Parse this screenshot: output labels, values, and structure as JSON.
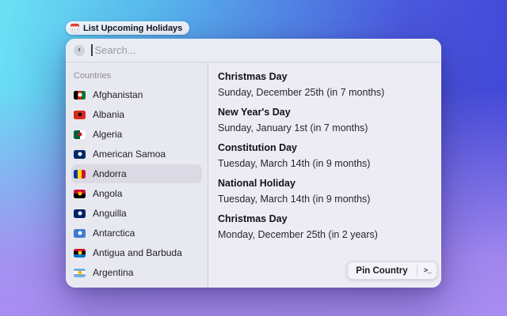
{
  "colors": {
    "bg_gradient_top_left": "#6be1f5",
    "bg_gradient_top_right": "#3f42d5",
    "bg_gradient_bottom": "#a88df0",
    "window_bg": "#eceaf4",
    "selected_row_bg": "#dbd9e3"
  },
  "launcher_pill": {
    "label": "List Upcoming Holidays",
    "icon": "calendar-icon"
  },
  "search": {
    "placeholder": "Search...",
    "value": "",
    "back_icon": "chevron-left-icon"
  },
  "sidebar": {
    "section_label": "Countries",
    "items": [
      {
        "name": "Afghanistan",
        "selected": false,
        "flag": {
          "dir": "v",
          "colors": [
            "#000000",
            "#d32011",
            "#007a36"
          ],
          "dot": "#ffffff"
        }
      },
      {
        "name": "Albania",
        "selected": false,
        "flag": {
          "dir": "v",
          "colors": [
            "#da291c"
          ],
          "dot": "#14100e"
        }
      },
      {
        "name": "Algeria",
        "selected": false,
        "flag": {
          "dir": "v",
          "colors": [
            "#006233",
            "#ffffff"
          ],
          "dot": "#d21034"
        }
      },
      {
        "name": "American Samoa",
        "selected": false,
        "flag": {
          "dir": "h",
          "colors": [
            "#002868"
          ],
          "dot": "#ffffff"
        }
      },
      {
        "name": "Andorra",
        "selected": true,
        "flag": {
          "dir": "v",
          "colors": [
            "#1035a8",
            "#fedd00",
            "#d0103a"
          ],
          "dot": null
        }
      },
      {
        "name": "Angola",
        "selected": false,
        "flag": {
          "dir": "h",
          "colors": [
            "#cc092f",
            "#000000"
          ],
          "dot": "#ffcb00"
        }
      },
      {
        "name": "Anguilla",
        "selected": false,
        "flag": {
          "dir": "h",
          "colors": [
            "#012169"
          ],
          "dot": "#ffffff"
        }
      },
      {
        "name": "Antarctica",
        "selected": false,
        "flag": {
          "dir": "h",
          "colors": [
            "#3a7dce"
          ],
          "dot": "#ffffff"
        }
      },
      {
        "name": "Antigua and Barbuda",
        "selected": false,
        "flag": {
          "dir": "h",
          "colors": [
            "#ce1126",
            "#000000",
            "#0072c6"
          ],
          "dot": "#fcd116"
        }
      },
      {
        "name": "Argentina",
        "selected": false,
        "flag": {
          "dir": "h",
          "colors": [
            "#74acdf",
            "#ffffff",
            "#74acdf"
          ],
          "dot": "#f6b40e"
        }
      }
    ]
  },
  "detail": {
    "holidays": [
      {
        "title": "Christmas Day",
        "date": "Sunday, December 25th (in 7 months)"
      },
      {
        "title": "New Year's Day",
        "date": "Sunday, January 1st (in 7 months)"
      },
      {
        "title": "Constitution Day",
        "date": "Tuesday, March 14th (in 9 months)"
      },
      {
        "title": "National Holiday",
        "date": "Tuesday, March 14th (in 9 months)"
      },
      {
        "title": "Christmas Day",
        "date": "Monday, December 25th (in 2 years)"
      }
    ]
  },
  "footer": {
    "pin_button_label": "Pin Country",
    "shortcut_glyph": ">_",
    "shortcut_icon": "terminal-prompt-icon"
  }
}
